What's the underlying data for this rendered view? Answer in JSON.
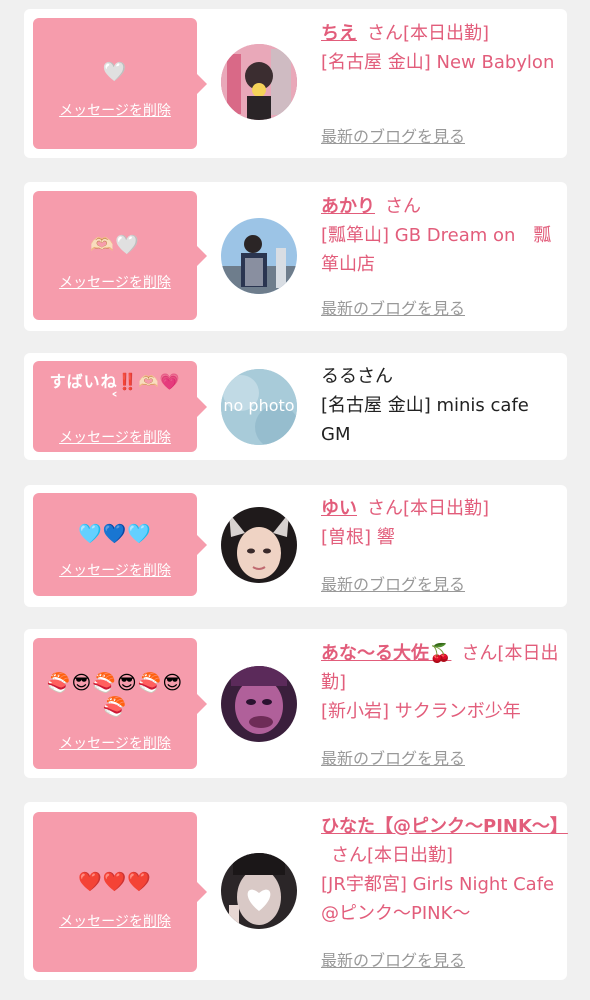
{
  "accent_color": "#e25d7b",
  "bubble_color": "#f69cac",
  "entries": [
    {
      "message": "🤍",
      "delete_label": "メッセージを削除",
      "name": "ちえ",
      "suffix": "さん[本日出勤]",
      "shop": "[名古屋 金山] New Babylon",
      "blog_label": "最新のブログを見る"
    },
    {
      "message": "🫶🏻🤍",
      "delete_label": "メッセージを削除",
      "name": "あかり",
      "suffix": "さん",
      "shop": "[瓢箪山] GB Dream on　瓢箪山店",
      "blog_label": "最新のブログを見る"
    },
    {
      "message": "すばいね‼️🫶🏻💗",
      "message_tail": "˂",
      "delete_label": "メッセージを削除",
      "name": "るるさん",
      "avatar_text": "no photo",
      "shop": "[名古屋 金山] minis cafe GM"
    },
    {
      "message": "🩵💙🩵",
      "delete_label": "メッセージを削除",
      "name": "ゆい",
      "suffix": "さん[本日出勤]",
      "shop": "[曽根] 響",
      "blog_label": "最新のブログを見る"
    },
    {
      "message": "🍣😎🍣😎🍣😎 🍣",
      "delete_label": "メッセージを削除",
      "name": "あな〜る大佐🍒",
      "suffix": "さん[本日出勤]",
      "shop": "[新小岩] サクランボ少年",
      "blog_label": "最新のブログを見る"
    },
    {
      "message": "❤️❤️❤️",
      "delete_label": "メッセージを削除",
      "name": "ひなた【@ピンク〜PINK〜】",
      "suffix": "さん[本日出勤]",
      "shop": "[JR宇都宮] Girls Night Cafe @ピンク〜PINK〜",
      "blog_label": "最新のブログを見る"
    }
  ]
}
